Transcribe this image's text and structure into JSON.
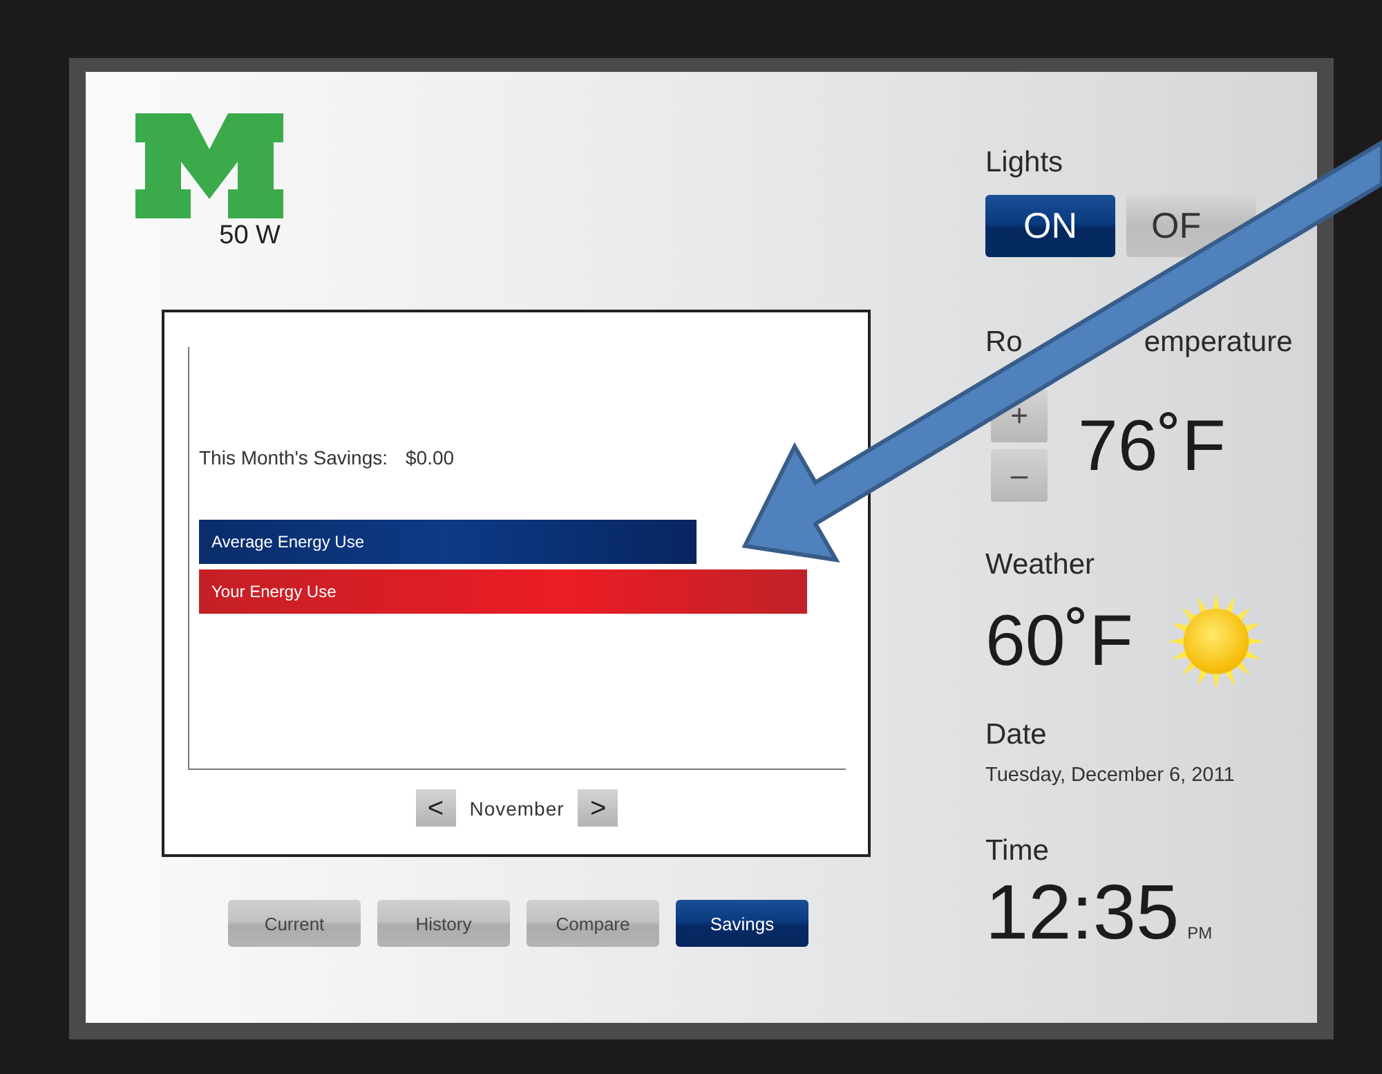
{
  "logo": {
    "subtitle": "50 W"
  },
  "savings_panel": {
    "label": "This Month's Savings:",
    "value": "$0.00",
    "bars": [
      {
        "label": "Average Energy Use",
        "kind": "average"
      },
      {
        "label": "Your Energy Use",
        "kind": "yours"
      }
    ],
    "month_nav": {
      "previous": "<",
      "month": "November",
      "next": ">"
    }
  },
  "tabs": [
    {
      "label": "Current",
      "selected": false
    },
    {
      "label": "History",
      "selected": false
    },
    {
      "label": "Compare",
      "selected": false
    },
    {
      "label": "Savings",
      "selected": true
    }
  ],
  "lights": {
    "title": "Lights",
    "options": [
      {
        "label": "ON",
        "selected": true
      },
      {
        "label": "OF",
        "selected": false
      }
    ]
  },
  "room_temperature": {
    "title_parts": [
      "Ro",
      "emperature"
    ],
    "increase": "+",
    "decrease": "–",
    "value": "76˚F"
  },
  "weather": {
    "title": "Weather",
    "value": "60˚F"
  },
  "date": {
    "title": "Date",
    "value": "Tuesday, December 6, 2011"
  },
  "time": {
    "title": "Time",
    "value": "12:35",
    "period": "PM"
  },
  "annotation": {
    "kind": "arrow"
  }
}
